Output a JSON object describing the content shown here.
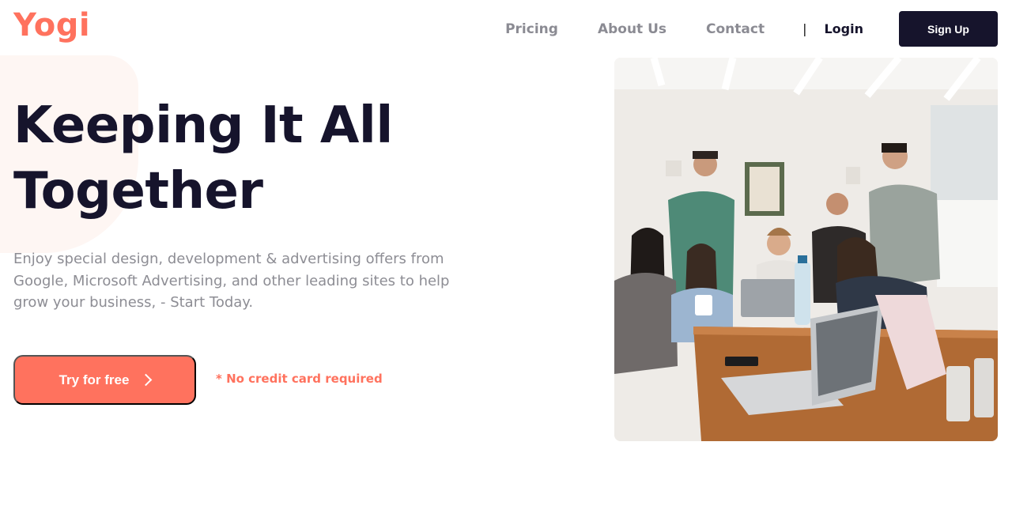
{
  "brand": {
    "name": "Yogi"
  },
  "colors": {
    "accent": "#ff725e",
    "dark": "#16142c",
    "muted": "#8d8d94"
  },
  "nav": {
    "links": [
      "Pricing",
      "About Us",
      "Contact"
    ],
    "divider": "|",
    "login_label": "Login",
    "signup_label": "Sign Up"
  },
  "hero": {
    "title_line1": "Keeping It All",
    "title_line2": "Together",
    "description": "Enjoy special design, development & advertising offers from Google, Microsoft Advertising, and other leading sites to help grow your business, - Start Today.",
    "cta_label": "Try for free",
    "cta_icon": "chevron-right-icon",
    "note": "* No credit card required"
  }
}
